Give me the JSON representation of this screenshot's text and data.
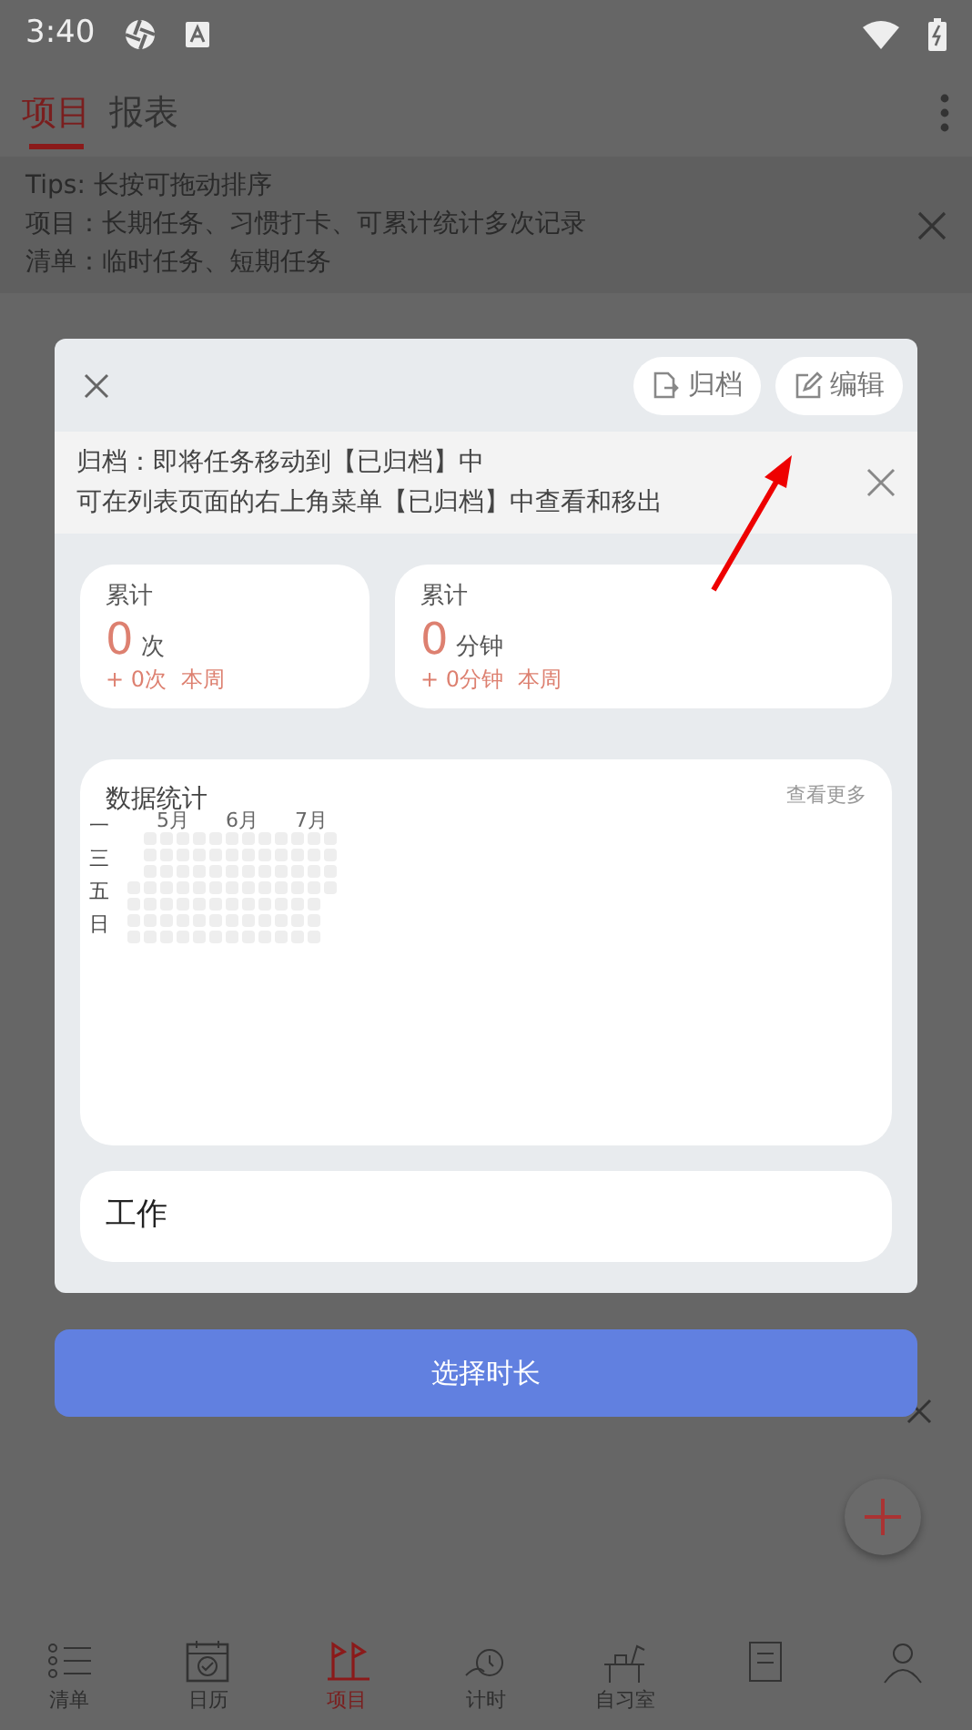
{
  "status_bar": {
    "time": "3:40"
  },
  "header": {
    "tabs": [
      {
        "label": "项目",
        "selected": true
      },
      {
        "label": "报表",
        "selected": false
      }
    ]
  },
  "tips": {
    "lines": [
      "Tips: 长按可拖动排序",
      "项目：长期任务、习惯打卡、可累计统计多次记录",
      "清单：临时任务、短期任务"
    ]
  },
  "dialog": {
    "actions": [
      {
        "label": "归档",
        "kind": "archive"
      },
      {
        "label": "编辑",
        "kind": "edit"
      }
    ],
    "notice": [
      "归档：即将任务移动到【已归档】中",
      "可在列表页面的右上角菜单【已归档】中查看和移出"
    ],
    "stats": [
      {
        "title": "累计",
        "value": "0",
        "unit": "次",
        "delta": "+ 0次",
        "period": "本周"
      },
      {
        "title": "累计",
        "value": "0",
        "unit": "分钟",
        "delta": "+ 0分钟",
        "period": "本周"
      }
    ],
    "activity": {
      "title": "数据统计",
      "more": "查看更多",
      "months": [
        "5月",
        "6月",
        "7月"
      ],
      "days": [
        "一",
        "三",
        "五",
        "日"
      ]
    },
    "category": "工作"
  },
  "primary_button": "选择时长",
  "bottom_nav": [
    {
      "label": "清单",
      "kind": "list",
      "selected": false
    },
    {
      "label": "日历",
      "kind": "calendar",
      "selected": false
    },
    {
      "label": "项目",
      "kind": "flags",
      "selected": true
    },
    {
      "label": "计时",
      "kind": "timer",
      "selected": false
    },
    {
      "label": "自习室",
      "kind": "desk",
      "selected": false
    },
    {
      "kind": "notebook",
      "selected": false
    },
    {
      "kind": "person",
      "selected": false
    }
  ]
}
